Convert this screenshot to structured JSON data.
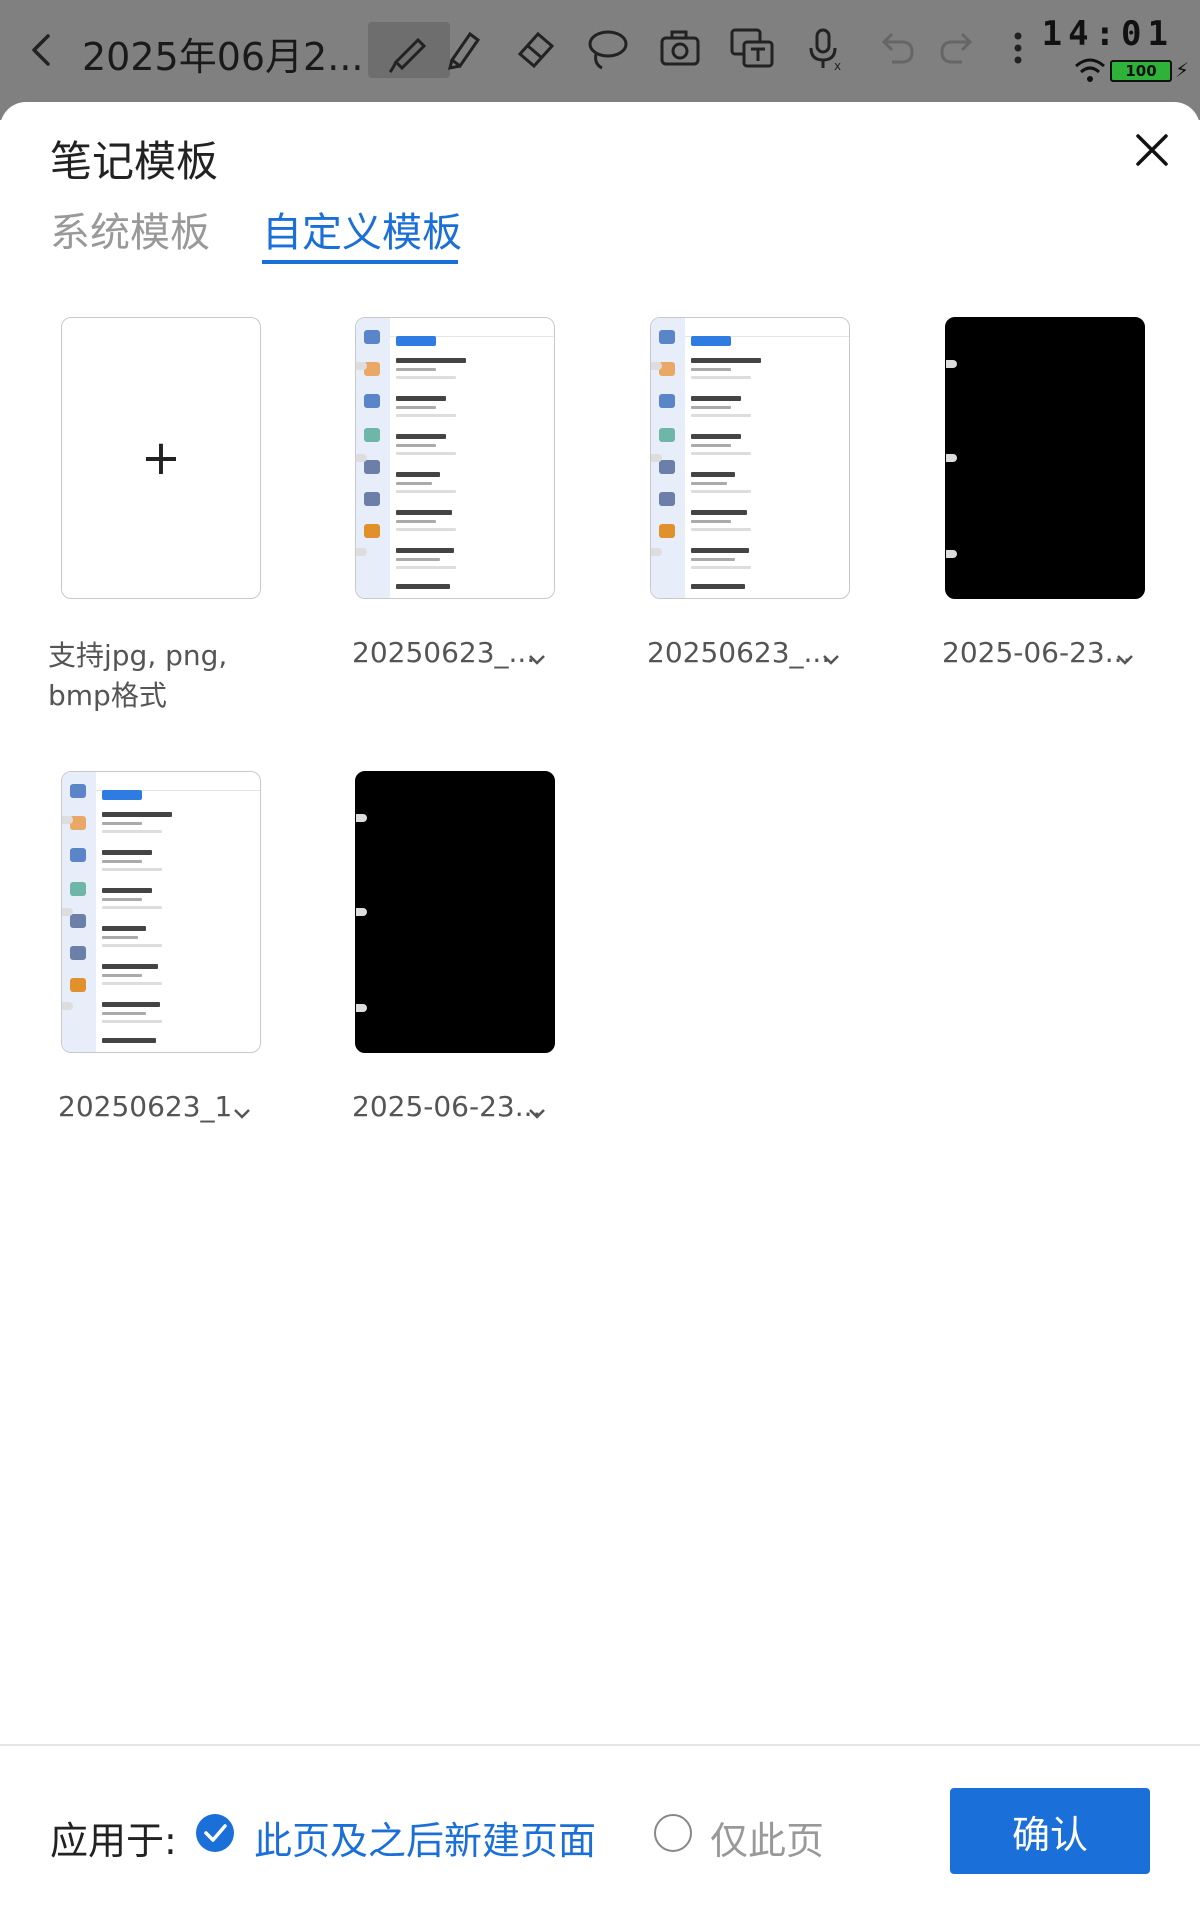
{
  "topbar": {
    "title": "2025年06月2...",
    "time": "14:01",
    "battery": "100"
  },
  "sheet": {
    "title": "笔记模板",
    "tabs": [
      {
        "label": "系统模板",
        "active": false
      },
      {
        "label": "自定义模板",
        "active": true
      }
    ]
  },
  "templates": [
    {
      "kind": "add",
      "caption": "支持jpg, png, bmp格式"
    },
    {
      "kind": "screenshot",
      "caption": "20250623_..."
    },
    {
      "kind": "screenshot",
      "caption": "20250623_..."
    },
    {
      "kind": "black",
      "caption": "2025-06-23..."
    },
    {
      "kind": "screenshot",
      "caption": "20250623_1"
    },
    {
      "kind": "black",
      "caption": "2025-06-23..."
    }
  ],
  "footer": {
    "apply_label": "应用于:",
    "option_all": "此页及之后新建页面",
    "option_this": "仅此页",
    "confirm": "确认"
  },
  "colors": {
    "accent": "#1a6fd8",
    "toolbar_bg": "#808080"
  }
}
